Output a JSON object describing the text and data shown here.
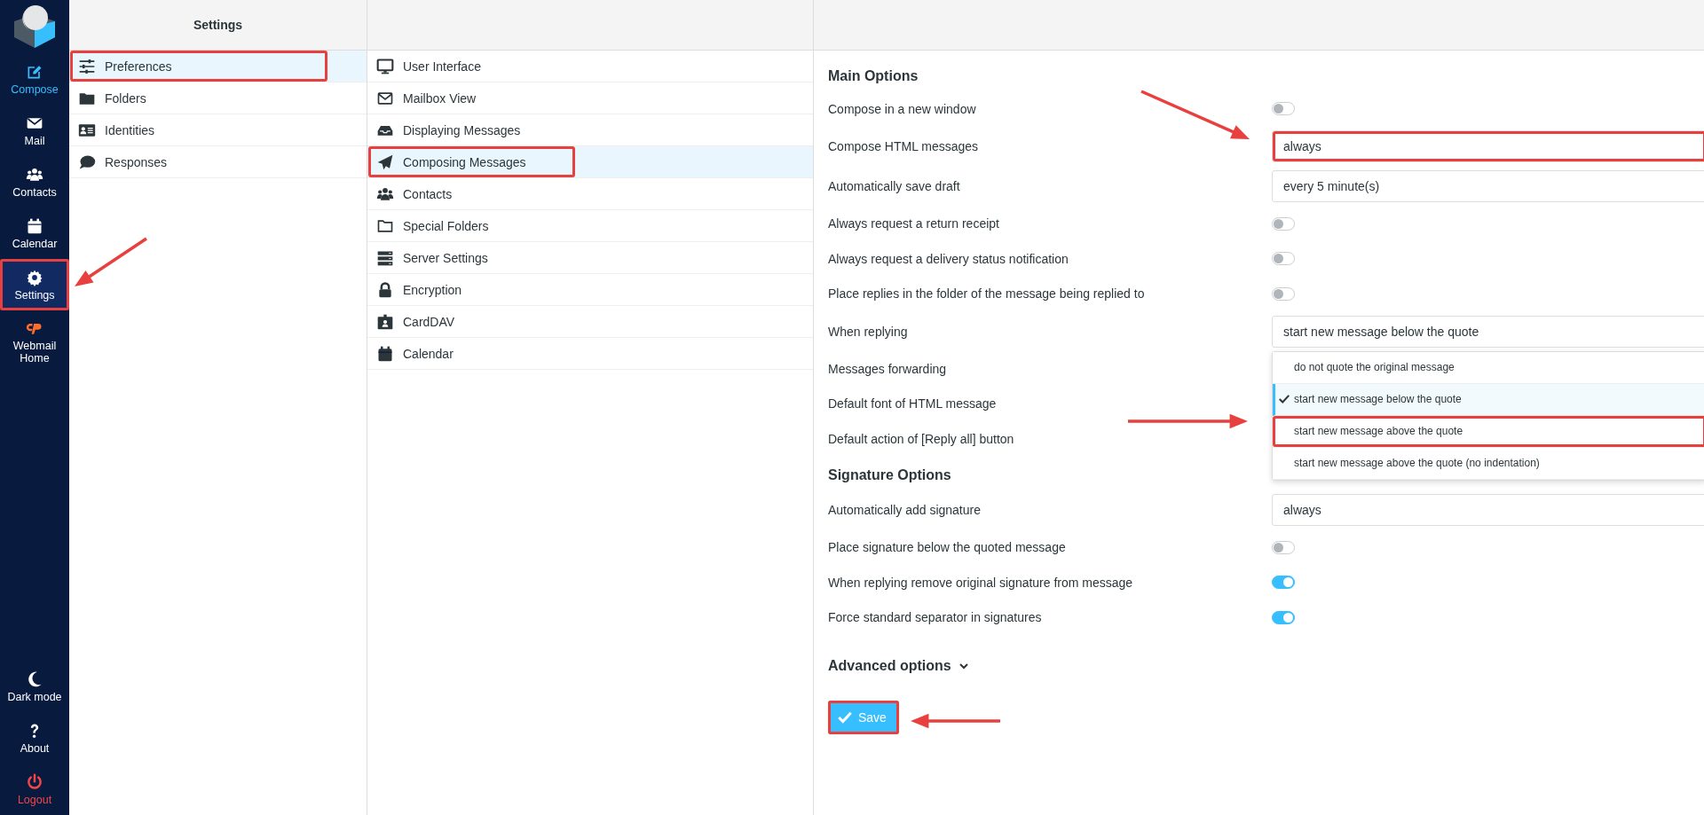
{
  "nav": {
    "items": [
      {
        "label": "Compose",
        "selected": false,
        "accent": true,
        "highlighted": false
      },
      {
        "label": "Mail",
        "selected": false,
        "accent": false,
        "highlighted": false
      },
      {
        "label": "Contacts",
        "selected": false,
        "accent": false,
        "highlighted": false
      },
      {
        "label": "Calendar",
        "selected": false,
        "accent": false,
        "highlighted": false
      },
      {
        "label": "Settings",
        "selected": true,
        "accent": false,
        "highlighted": true
      },
      {
        "label": "Webmail Home",
        "selected": false,
        "accent": false,
        "highlighted": false
      }
    ],
    "bottom": [
      {
        "label": "Dark mode",
        "danger": false
      },
      {
        "label": "About",
        "danger": false
      },
      {
        "label": "Logout",
        "danger": true
      }
    ]
  },
  "settings": {
    "title": "Settings",
    "items": [
      {
        "label": "Preferences",
        "selected": true,
        "highlighted": true
      },
      {
        "label": "Folders",
        "selected": false,
        "highlighted": false
      },
      {
        "label": "Identities",
        "selected": false,
        "highlighted": false
      },
      {
        "label": "Responses",
        "selected": false,
        "highlighted": false
      }
    ]
  },
  "sections": {
    "items": [
      {
        "label": "User Interface",
        "selected": false,
        "highlighted": false
      },
      {
        "label": "Mailbox View",
        "selected": false,
        "highlighted": false
      },
      {
        "label": "Displaying Messages",
        "selected": false,
        "highlighted": false
      },
      {
        "label": "Composing Messages",
        "selected": true,
        "highlighted": true
      },
      {
        "label": "Contacts",
        "selected": false,
        "highlighted": false
      },
      {
        "label": "Special Folders",
        "selected": false,
        "highlighted": false
      },
      {
        "label": "Server Settings",
        "selected": false,
        "highlighted": false
      },
      {
        "label": "Encryption",
        "selected": false,
        "highlighted": false
      },
      {
        "label": "CardDAV",
        "selected": false,
        "highlighted": false
      },
      {
        "label": "Calendar",
        "selected": false,
        "highlighted": false
      }
    ]
  },
  "groups": [
    {
      "title": "Main Options",
      "options": [
        {
          "kind": "toggle",
          "label": "Compose in a new window",
          "on": false
        },
        {
          "kind": "select",
          "label": "Compose HTML messages",
          "value": "always",
          "highlighted": true
        },
        {
          "kind": "select",
          "label": "Automatically save draft",
          "value": "every 5 minute(s)",
          "highlighted": false
        },
        {
          "kind": "toggle",
          "label": "Always request a return receipt",
          "on": false
        },
        {
          "kind": "toggle",
          "label": "Always request a delivery status notification",
          "on": false
        },
        {
          "kind": "toggle",
          "label": "Place replies in the folder of the message being replied to",
          "on": false
        },
        {
          "kind": "select",
          "label": "When replying",
          "value": "start new message below the quote",
          "highlighted": false,
          "options": [
            {
              "label": "do not quote the original message",
              "selected": false,
              "highlighted": false
            },
            {
              "label": "start new message below the quote",
              "selected": true,
              "highlighted": false
            },
            {
              "label": "start new message above the quote",
              "selected": false,
              "highlighted": true
            },
            {
              "label": "start new message above the quote (no indentation)",
              "selected": false,
              "highlighted": false
            }
          ]
        },
        {
          "kind": "covered",
          "label": "Messages forwarding"
        },
        {
          "kind": "covered",
          "label": "Default font of HTML message"
        },
        {
          "kind": "covered",
          "label": "Default action of [Reply all] button"
        }
      ]
    },
    {
      "title": "Signature Options",
      "options": [
        {
          "kind": "select",
          "label": "Automatically add signature",
          "value": "always",
          "highlighted": false
        },
        {
          "kind": "toggle",
          "label": "Place signature below the quoted message",
          "on": false
        },
        {
          "kind": "toggle",
          "label": "When replying remove original signature from message",
          "on": true
        },
        {
          "kind": "toggle",
          "label": "Force standard separator in signatures",
          "on": true
        }
      ]
    }
  ],
  "advanced": {
    "label": "Advanced options",
    "expanded": false
  },
  "save": {
    "label": "Save",
    "highlighted": true
  }
}
